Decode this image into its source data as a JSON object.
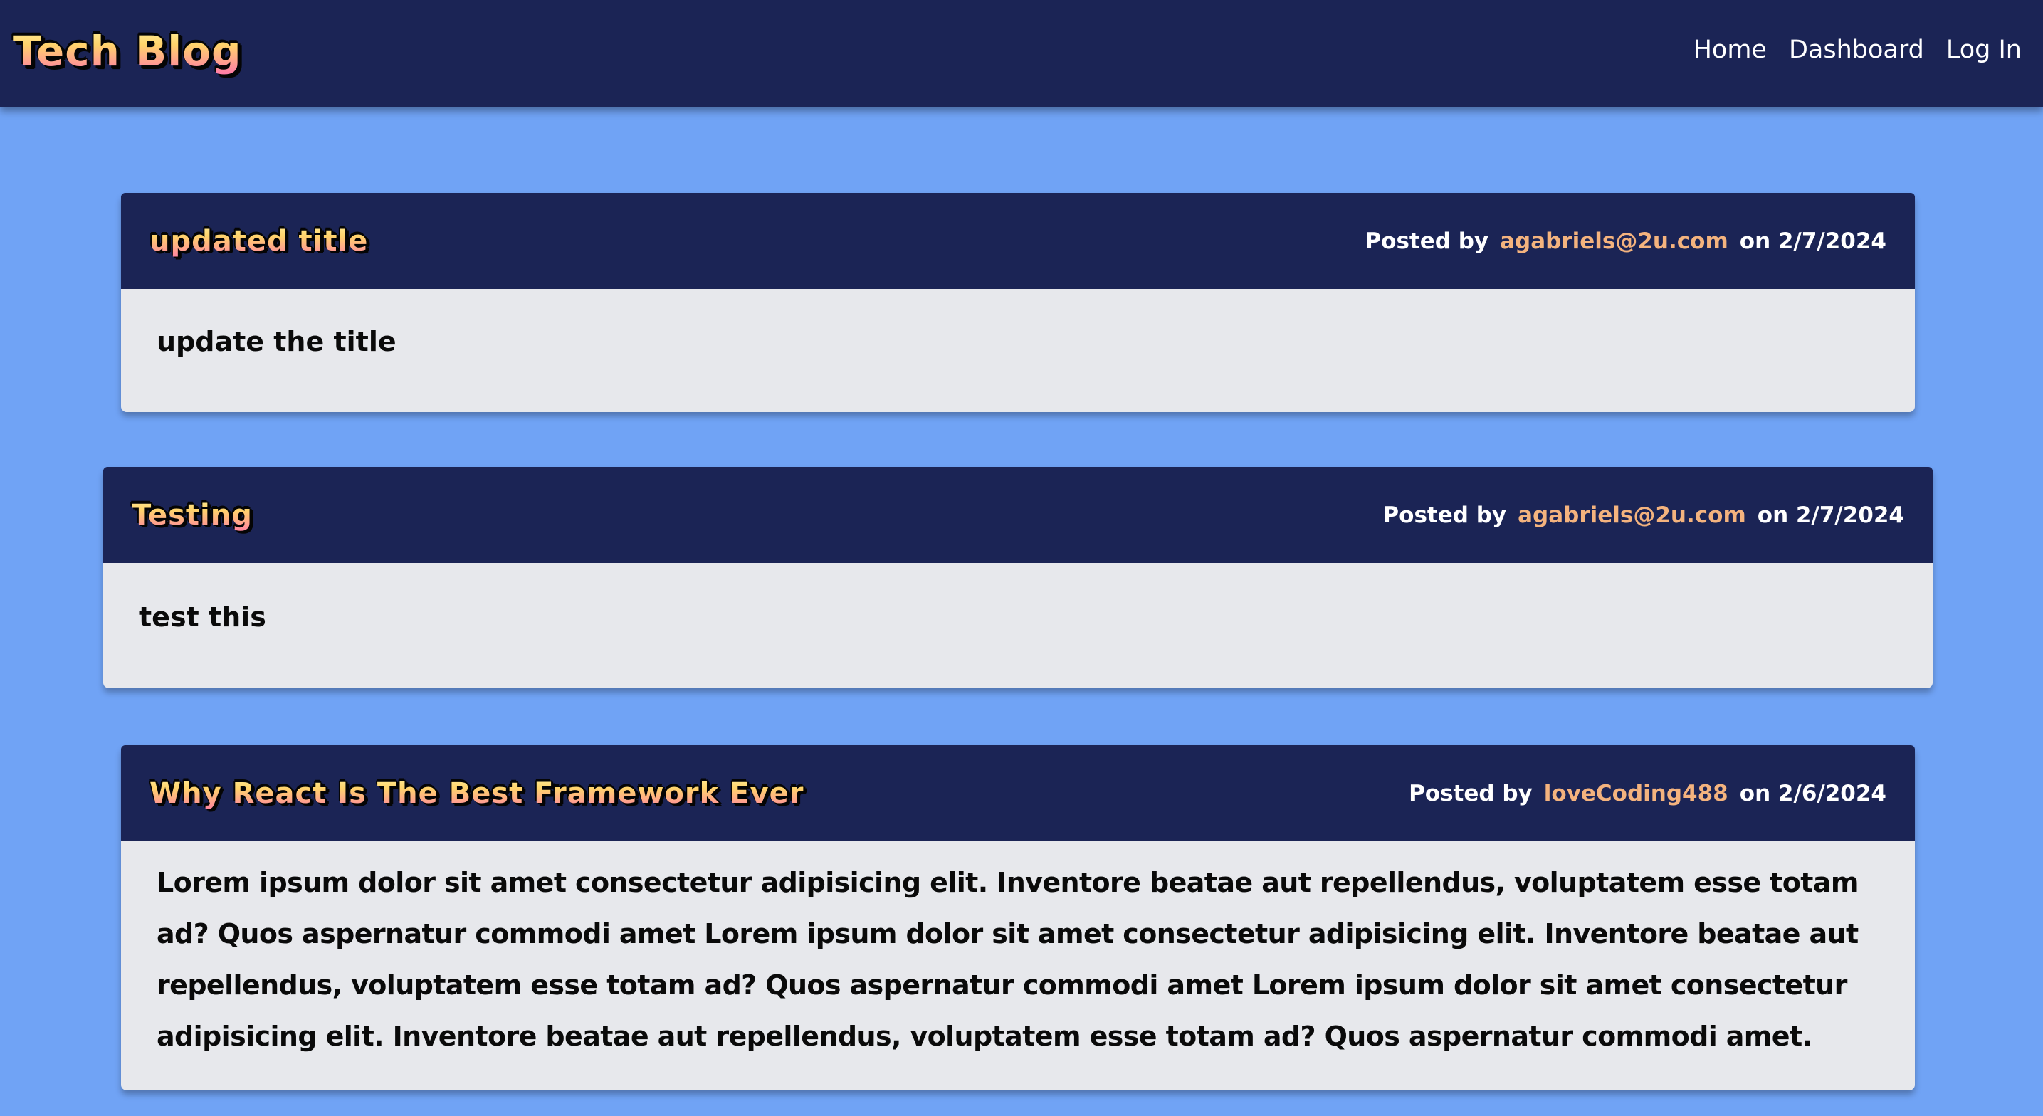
{
  "header": {
    "logo": "Tech Blog",
    "nav": [
      {
        "label": "Home"
      },
      {
        "label": "Dashboard"
      },
      {
        "label": "Log In"
      }
    ]
  },
  "posts": [
    {
      "title": "updated title",
      "posted_by_label": "Posted by",
      "author": "agabriels@2u.com",
      "date_text": "on 2/7/2024",
      "body": "update the title"
    },
    {
      "title": "Testing",
      "posted_by_label": "Posted by",
      "author": "agabriels@2u.com",
      "date_text": "on 2/7/2024",
      "body": "test this"
    },
    {
      "title": "Why React Is The Best Framework Ever",
      "posted_by_label": "Posted by",
      "author": "loveCoding488",
      "date_text": "on 2/6/2024",
      "body": "Lorem ipsum dolor sit amet consectetur adipisicing elit. Inventore beatae aut repellendus, voluptatem esse totam ad? Quos aspernatur commodi amet Lorem ipsum dolor sit amet consectetur adipisicing elit. Inventore beatae aut repellendus, voluptatem esse totam ad? Quos aspernatur commodi amet Lorem ipsum dolor sit amet consectetur adipisicing elit. Inventore beatae aut repellendus, voluptatem esse totam ad? Quos aspernatur commodi amet."
    }
  ],
  "colors": {
    "page_background": "#70a3f5",
    "header_background": "#1b2455",
    "card_body_background": "#e7e8ec",
    "author_link": "#f4b37e"
  }
}
